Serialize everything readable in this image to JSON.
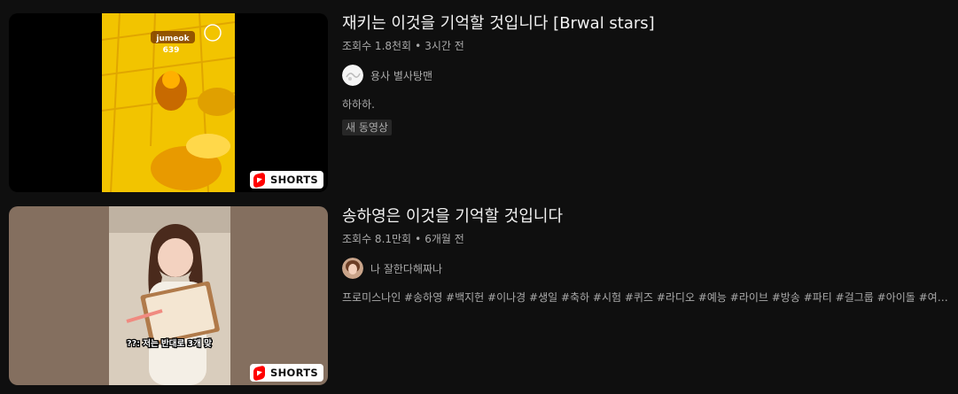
{
  "videos": [
    {
      "title": "재키는 이것을 기억할 것입니다 [Brwal stars]",
      "views": "조회수 1.8천회",
      "age": "3시간 전",
      "channel": "용사 별사탕맨",
      "description": "하하하.",
      "badge": "새 동영상",
      "shorts_label": "SHORTS",
      "thumb_text_top": "jumeok",
      "thumb_text_num": "639"
    },
    {
      "title": "송하영은 이것을 기억할 것입니다",
      "views": "조회수 8.1만회",
      "age": "6개월 전",
      "channel": "나 잘한다해짜나",
      "description": "프로미스나인 #송하영 #백지헌 #이나경 #생일 #축하 #시험 #퀴즈 #라디오 #예능 #라이브 #방송 #파티 #걸그룹 #아이돌 #여돌 ...",
      "shorts_label": "SHORTS",
      "thumb_caption": "??: 저는 반대로 3개 맞"
    }
  ],
  "separator": "•",
  "colors": {
    "background": "#0f0f0f",
    "text": "#f1f1f1",
    "secondary": "#aaaaaa",
    "shorts_red": "#ff0000"
  },
  "icons": {
    "shorts": "shorts-icon"
  }
}
